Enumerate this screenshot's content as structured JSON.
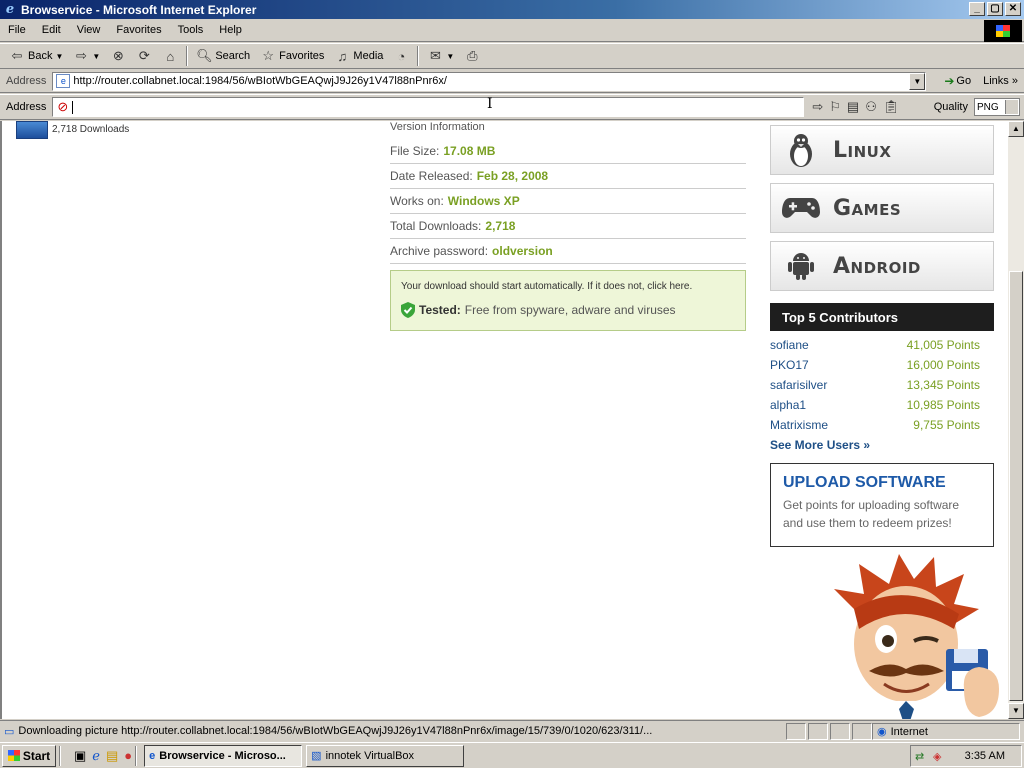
{
  "window": {
    "title": "Browservice - Microsoft Internet Explorer",
    "btn_min": "_",
    "btn_max": "▢",
    "btn_close": "✕"
  },
  "menu": [
    "File",
    "Edit",
    "View",
    "Favorites",
    "Tools",
    "Help"
  ],
  "toolbar": {
    "back": "Back",
    "search": "Search",
    "favorites": "Favorites",
    "media": "Media"
  },
  "address": {
    "label": "Address",
    "url": "http://router.collabnet.local:1984/56/wBIotWbGEAQwjJ9J26y1V47l88nPnr6x/",
    "go": "Go",
    "links": "Links"
  },
  "addon_bar": {
    "label": "Address",
    "value": "",
    "quality_label": "Quality",
    "quality_value": "PNG"
  },
  "page": {
    "downloads": "2,718 Downloads",
    "info_head": "Version Information",
    "info_rows": [
      {
        "label": "File Size:",
        "value": "17.08 MB"
      },
      {
        "label": "Date Released:",
        "value": "Feb 28, 2008"
      },
      {
        "label": "Works on:",
        "value": "Windows XP"
      },
      {
        "label": "Total Downloads:",
        "value": "2,718"
      },
      {
        "label": "Archive password:",
        "value": "oldversion"
      }
    ],
    "download_msg": "Your download should start automatically. If it does not, click here.",
    "tested_label": "Tested:",
    "tested_text": "Free from spyware, adware and viruses",
    "platforms": [
      "Linux",
      "Games",
      "Android"
    ],
    "contributors_title": "Top 5 Contributors",
    "contributors": [
      {
        "name": "sofiane",
        "points": "41,005 Points"
      },
      {
        "name": "PKO17",
        "points": "16,000 Points"
      },
      {
        "name": "safarisilver",
        "points": "13,345 Points"
      },
      {
        "name": "alpha1",
        "points": "10,985 Points"
      },
      {
        "name": "Matrixisme",
        "points": "9,755 Points"
      }
    ],
    "see_more": "See More Users »",
    "upload_title": "UPLOAD SOFTWARE",
    "upload_desc": "Get points for uploading software and use them to redeem prizes!"
  },
  "status": {
    "text": "Downloading picture http://router.collabnet.local:1984/56/wBIotWbGEAQwjJ9J26y1V47l88nPnr6x/image/15/739/0/1020/623/311/...",
    "zone": "Internet"
  },
  "taskbar": {
    "start": "Start",
    "tasks": [
      "Browservice - Microso...",
      "innotek VirtualBox"
    ],
    "clock": "3:35 AM"
  }
}
